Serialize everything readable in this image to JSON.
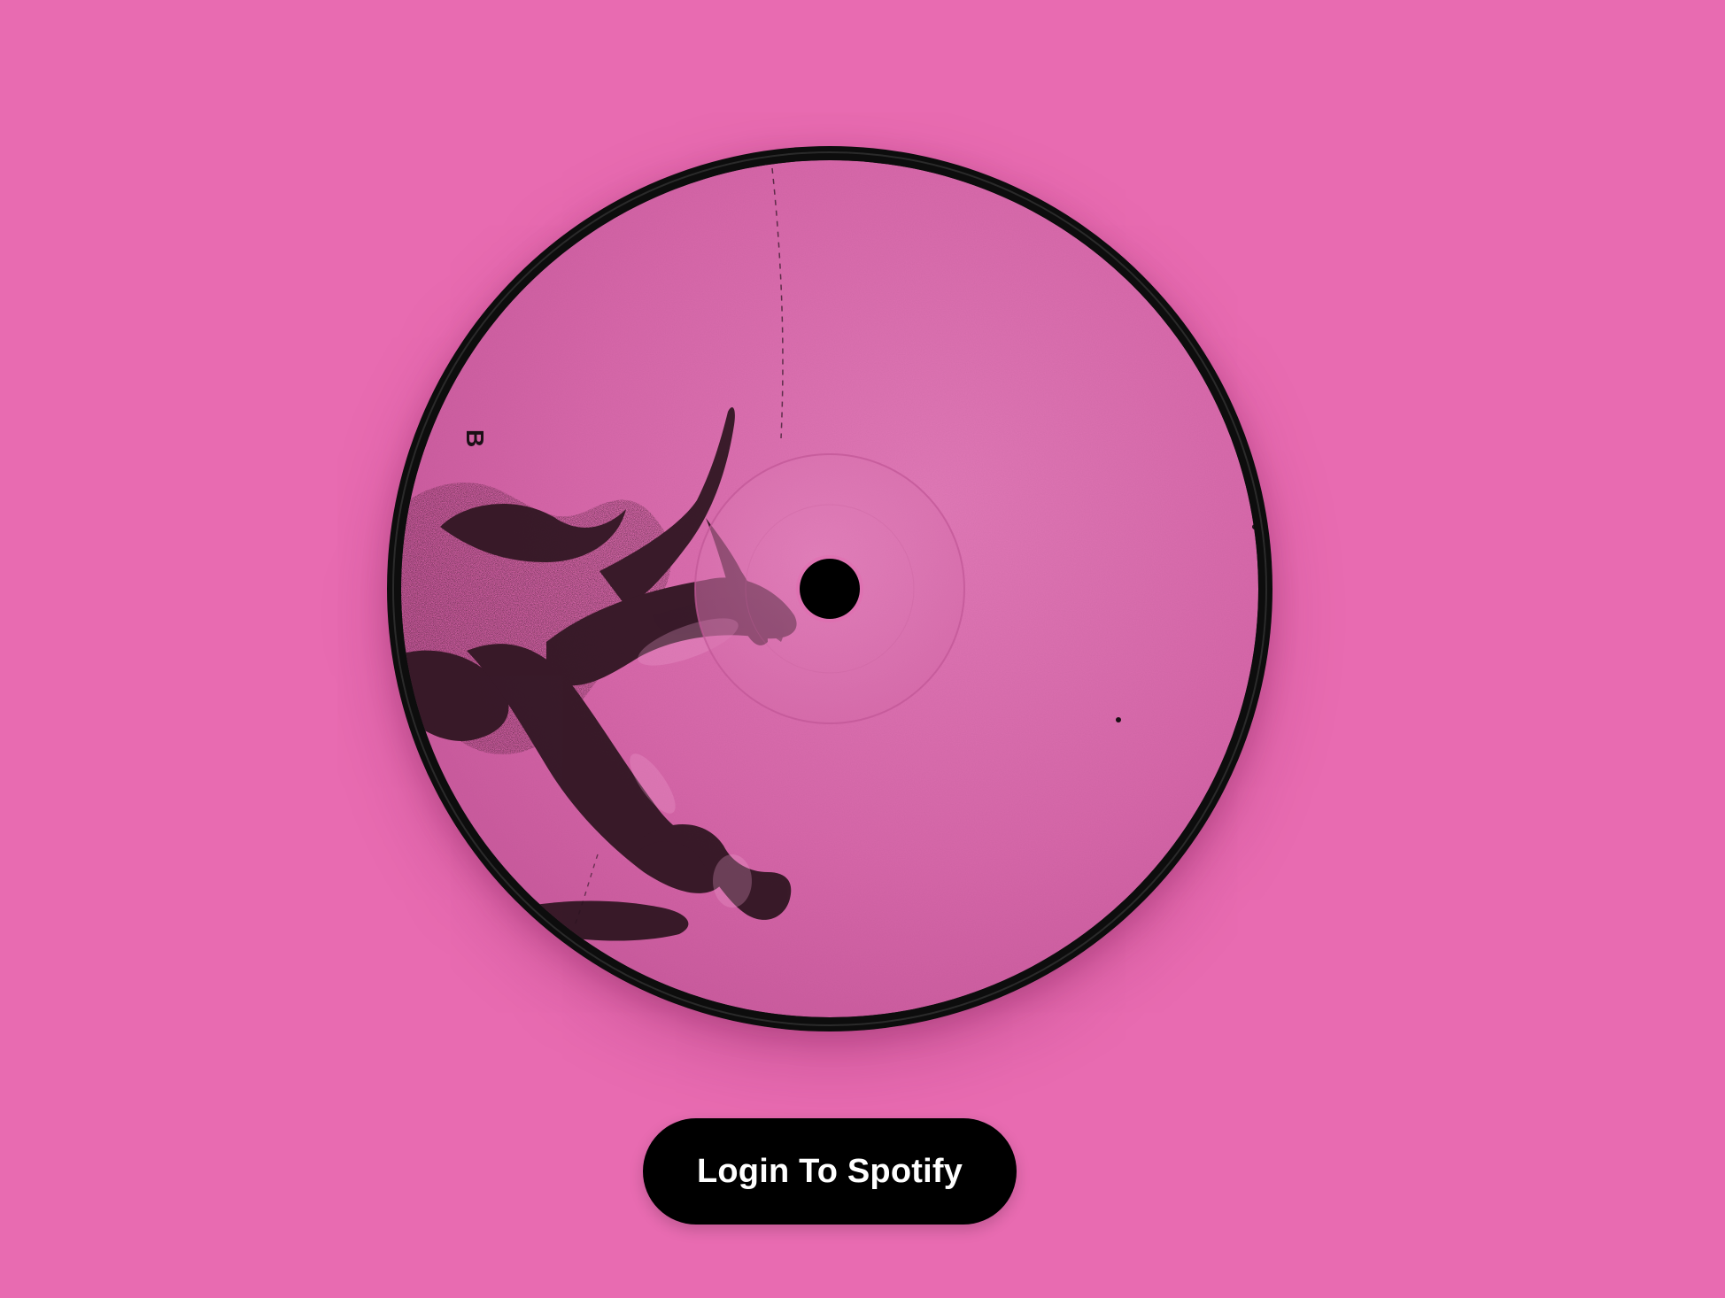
{
  "colors": {
    "background": "#e86bb1",
    "record_edge": "#0d0d0d",
    "label_pink": "#d968ad",
    "ink": "#1a0f15",
    "button_bg": "#000000",
    "button_text": "#ffffff"
  },
  "record": {
    "icon": "vinyl-record-icon",
    "label_letter": "B"
  },
  "login_button": {
    "label": "Login To Spotify"
  }
}
